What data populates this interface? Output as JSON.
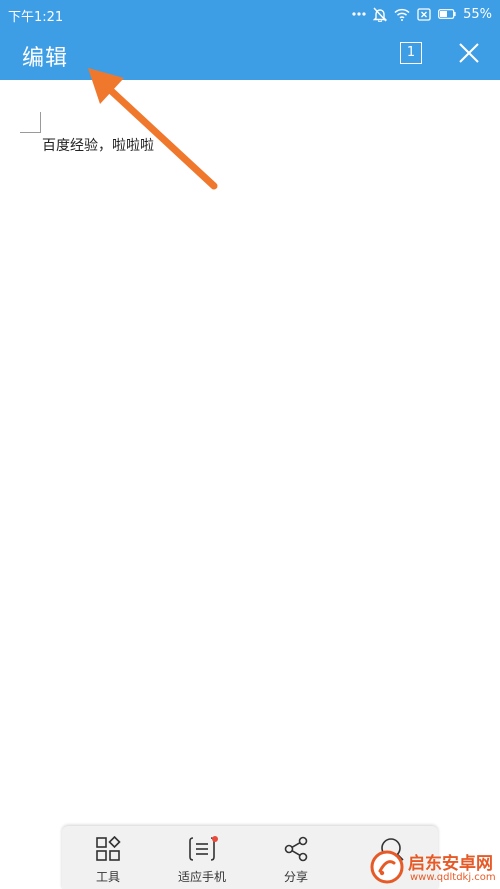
{
  "status_bar": {
    "time": "下午1:21",
    "battery": "55%",
    "icons": [
      "more-dots-icon",
      "mute-bell-icon",
      "wifi-icon",
      "sim-x-icon",
      "battery-icon"
    ]
  },
  "app_bar": {
    "title": "编辑",
    "page_count": "1",
    "background": "#3d9ee6"
  },
  "document": {
    "text": "百度经验，啦啦啦"
  },
  "annotation": {
    "arrow_color": "#f0782d",
    "target": "app-title"
  },
  "toolbar": {
    "items": [
      {
        "label": "工具",
        "icon": "tools-grid-icon"
      },
      {
        "label": "适应手机",
        "icon": "fit-phone-icon",
        "badge": true
      },
      {
        "label": "分享",
        "icon": "share-icon"
      },
      {
        "label": "",
        "icon": "search-icon"
      }
    ]
  },
  "watermark": {
    "brand": "启东安卓网",
    "url": "www.qdltdkj.com",
    "color": "#e65a27"
  }
}
